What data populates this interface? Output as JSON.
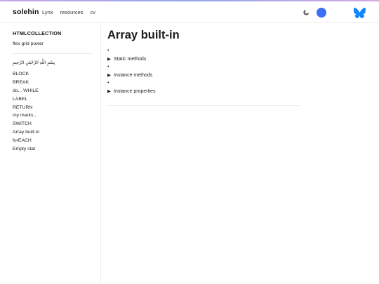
{
  "header": {
    "brand": "solehin",
    "nav": [
      "Lynx",
      "resources",
      "cv"
    ],
    "icons": {
      "theme_toggle": "moon-icon",
      "avatar": "blue-blob-icon",
      "social": "butterfly-icon"
    },
    "accent_color": "#3b6ff5",
    "butterfly_color": "#1185fe"
  },
  "sidebar": {
    "title": "HTMLCOLLECTION",
    "subtitle": "flex grid power",
    "arabic": "بِسْمِ اللَّهِ الرَّحْمَٰنِ الرَّحِيمِ",
    "items": [
      "BLOCK",
      "BREAK",
      "do... WHILE",
      "LABEL",
      "RETURN",
      "my marks...",
      "SWITCH",
      "Array built-in",
      "forEACH",
      "Empty stat"
    ]
  },
  "main": {
    "title": "Array built-in",
    "sections": [
      "Static methods",
      "Instance methods",
      "Instance properties"
    ],
    "bullet": "•",
    "disclosure": "▶"
  }
}
